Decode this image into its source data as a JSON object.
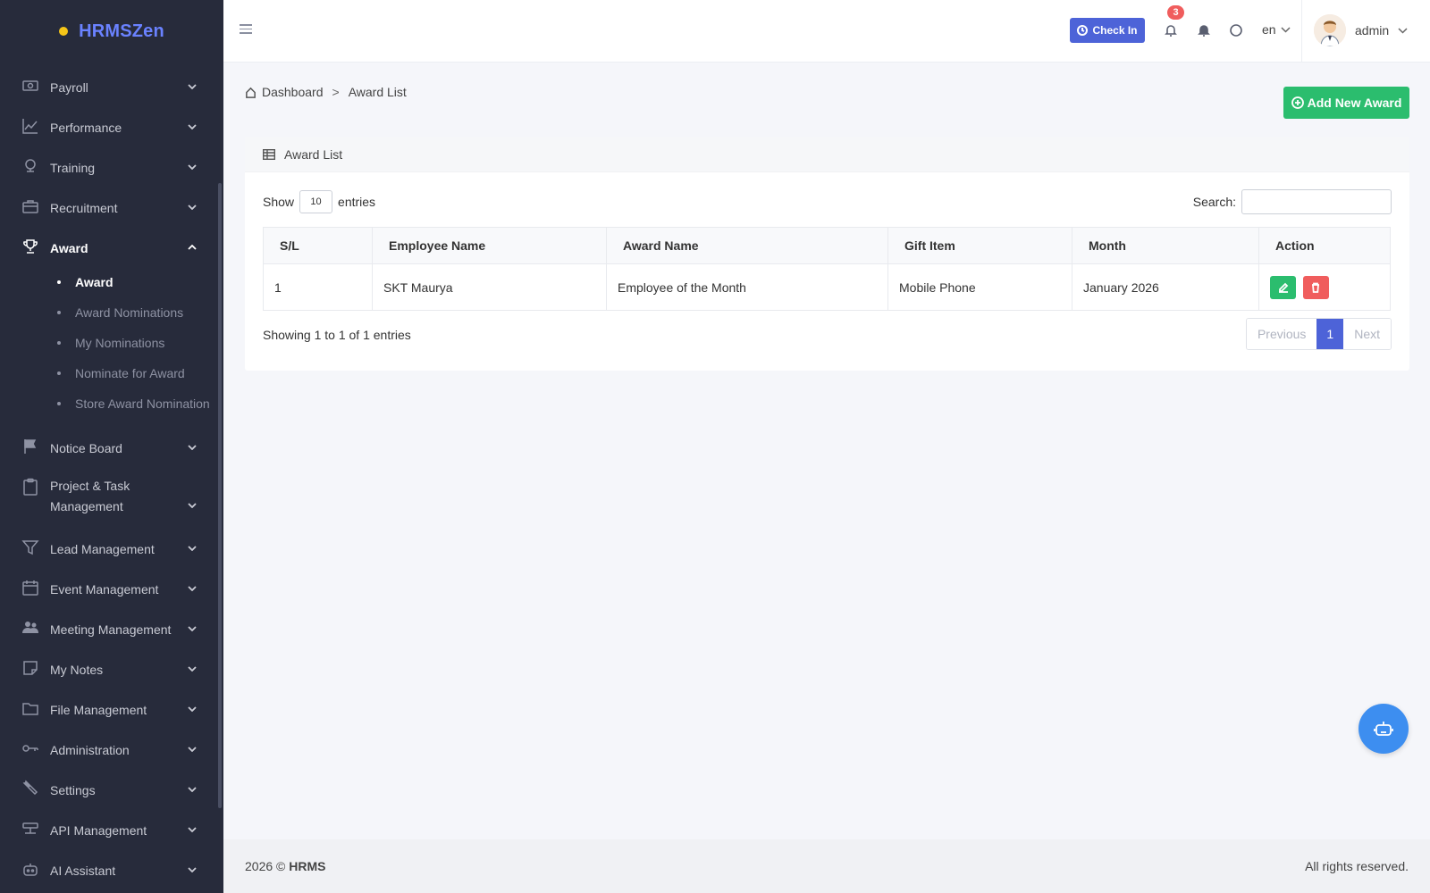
{
  "brand": {
    "name": "HRMSZen",
    "dot_color": "#f5c518",
    "name_color": "#6a82ff"
  },
  "sidebar": {
    "items": [
      {
        "label": "Payroll",
        "icon": "money-icon"
      },
      {
        "label": "Performance",
        "icon": "chart-line-icon"
      },
      {
        "label": "Training",
        "icon": "medal-icon"
      },
      {
        "label": "Recruitment",
        "icon": "briefcase-icon"
      },
      {
        "label": "Award",
        "icon": "trophy-icon",
        "active": true,
        "sub": [
          {
            "label": "Award",
            "active": true
          },
          {
            "label": "Award Nominations"
          },
          {
            "label": "My Nominations"
          },
          {
            "label": "Nominate for Award"
          },
          {
            "label": "Store Award Nomination"
          }
        ]
      },
      {
        "label": "Notice Board",
        "icon": "flag-icon"
      },
      {
        "label": "Project & Task Management",
        "icon": "clipboard-icon"
      },
      {
        "label": "Lead Management",
        "icon": "funnel-icon"
      },
      {
        "label": "Event Management",
        "icon": "calendar-icon"
      },
      {
        "label": "Meeting Management",
        "icon": "users-icon"
      },
      {
        "label": "My Notes",
        "icon": "note-icon"
      },
      {
        "label": "File Management",
        "icon": "folder-icon"
      },
      {
        "label": "Administration",
        "icon": "key-icon"
      },
      {
        "label": "Settings",
        "icon": "wrench-icon"
      },
      {
        "label": "API Management",
        "icon": "server-icon"
      },
      {
        "label": "AI Assistant",
        "icon": "robot-icon"
      }
    ]
  },
  "header": {
    "checkin_label": "Check In",
    "notification_count": "3",
    "language": "en",
    "user_name": "admin"
  },
  "breadcrumb": {
    "home": "Dashboard",
    "separator": ">",
    "current": "Award List"
  },
  "actions": {
    "add_label": "Add New Award"
  },
  "card": {
    "title": "Award List",
    "show_label": "Show",
    "entries_value": "10",
    "entries_label": "entries",
    "search_label": "Search:",
    "columns": [
      "S/L",
      "Employee Name",
      "Award Name",
      "Gift Item",
      "Month",
      "Action"
    ],
    "rows": [
      {
        "sl": "1",
        "employee": "SKT Maurya",
        "award": "Employee of the Month",
        "gift": "Mobile Phone",
        "month": "January 2026"
      }
    ],
    "info": "Showing 1 to 1 of 1 entries",
    "pagination": {
      "previous": "Previous",
      "current": "1",
      "next": "Next"
    }
  },
  "footer": {
    "year": "2026 ©",
    "brand": "HRMS",
    "rights": "All rights reserved."
  },
  "colors": {
    "sidebar_bg": "#272b3b",
    "primary": "#4d63d8",
    "success": "#2bbd6e",
    "danger": "#f05d5d",
    "fab": "#3d8ef0"
  }
}
